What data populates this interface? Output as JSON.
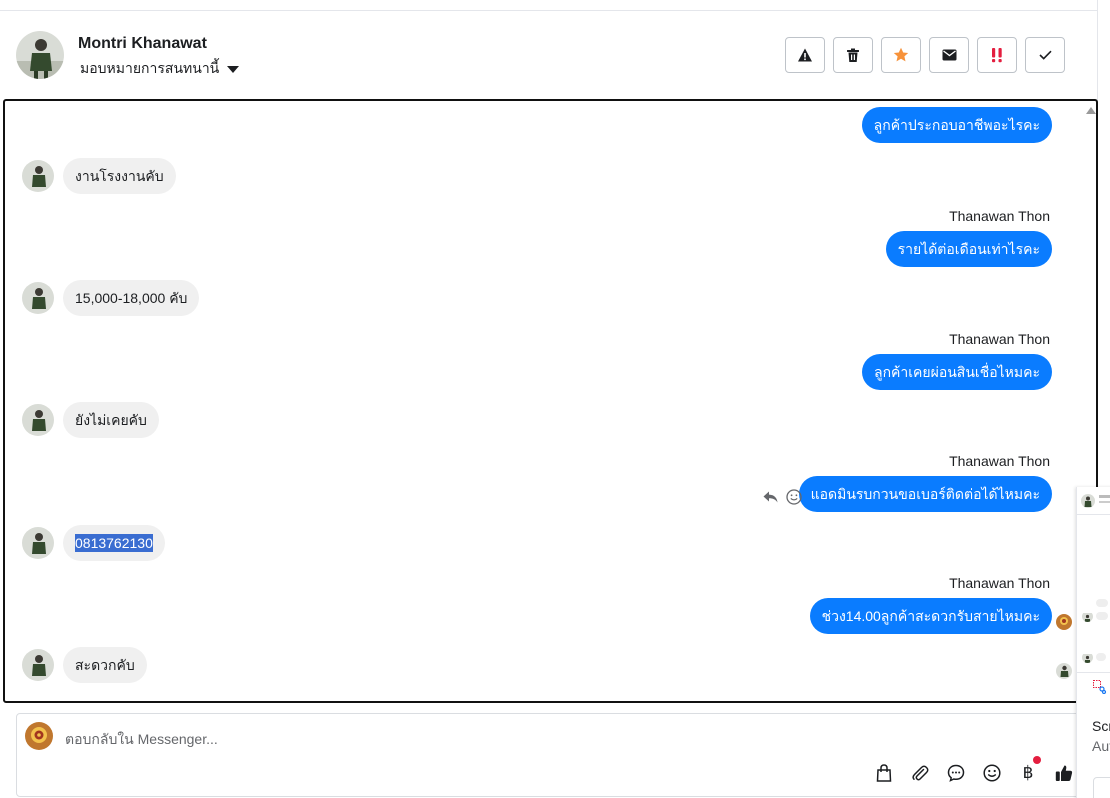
{
  "header": {
    "contact_name": "Montri Khanawat",
    "assign_label": "มอบหมายการสนทนานี้",
    "actions": [
      {
        "name": "report-button",
        "icon": "warning-icon"
      },
      {
        "name": "delete-button",
        "icon": "trash-icon"
      },
      {
        "name": "star-button",
        "icon": "star-icon",
        "color": "#f7923a"
      },
      {
        "name": "mark-unread-button",
        "icon": "envelope-icon"
      },
      {
        "name": "spam-button",
        "icon": "double-exclamation-icon",
        "color": "#e41e3f"
      },
      {
        "name": "mark-done-button",
        "icon": "check-icon"
      }
    ]
  },
  "messages": [
    {
      "dir": "out",
      "sender": "",
      "text": "ลูกค้าประกอบอาชีพอะไรคะ"
    },
    {
      "dir": "in",
      "text": "งานโรงงานคับ"
    },
    {
      "dir": "out",
      "sender": "Thanawan Thon",
      "text": "รายได้ต่อเดือนเท่าไรคะ"
    },
    {
      "dir": "in",
      "text": "15,000-18,000 คับ"
    },
    {
      "dir": "out",
      "sender": "Thanawan Thon",
      "text": "ลูกค้าเคยผ่อนสินเชื่อไหมคะ"
    },
    {
      "dir": "in",
      "text": "ยังไม่เคยคับ"
    },
    {
      "dir": "out",
      "sender": "Thanawan Thon",
      "text": "แอดมินรบกวนขอเบอร์ติดต่อได้ไหมคะ"
    },
    {
      "dir": "in",
      "text": "0813762130",
      "selected": true
    },
    {
      "dir": "out",
      "sender": "Thanawan Thon",
      "text": "ช่วง14.00ลูกค้าสะดวกรับสายไหมคะ"
    },
    {
      "dir": "in",
      "text": "สะดวกคับ"
    }
  ],
  "composer": {
    "placeholder": "ตอบกลับใน Messenger...",
    "tools": [
      "bag-icon",
      "paperclip-icon",
      "chat-bubble-icon",
      "emoji-icon",
      "baht-icon",
      "thumbs-up-icon"
    ],
    "baht_symbol": "฿"
  },
  "side_panel": {
    "line1": "Scr",
    "line2": "Aut"
  },
  "colors": {
    "outgoing_bubble": "#0a7cff",
    "incoming_bubble": "#f0f0f0",
    "selection": "#3a6dd1"
  }
}
